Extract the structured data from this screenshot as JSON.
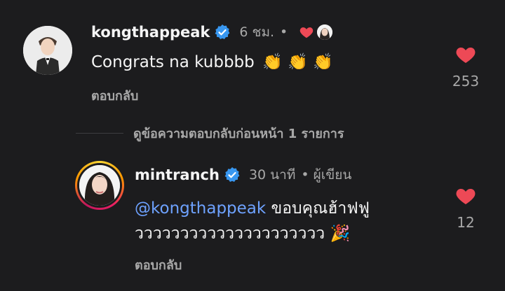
{
  "comments": [
    {
      "username": "kongthappeak",
      "time": "6 ชม.",
      "separator": "•",
      "text": "Congrats na kubbbb",
      "claps": "👏 👏 👏",
      "reply_label": "ตอบกลับ",
      "likes": "253",
      "liked_by_author": true
    },
    {
      "username": "mintranch",
      "time": "30 นาที",
      "separator": "•",
      "author_label": "ผู้เขียน",
      "mention": "@kongthappeak",
      "text_line1": "ขอบคุณฮ้าฟฟู",
      "text_line2": "ววววววววววววววววววววว",
      "emoji": "🎉",
      "reply_label": "ตอบกลับ",
      "likes": "12"
    }
  ],
  "view_previous_replies": "ดูข้อความตอบกลับก่อนหน้า 1 รายการ",
  "colors": {
    "background": "#1c1c1e",
    "like_heart": "#ed4956",
    "verified": "#3897f0",
    "mention": "#6ea2ff",
    "secondary_text": "#a8a8a8"
  }
}
